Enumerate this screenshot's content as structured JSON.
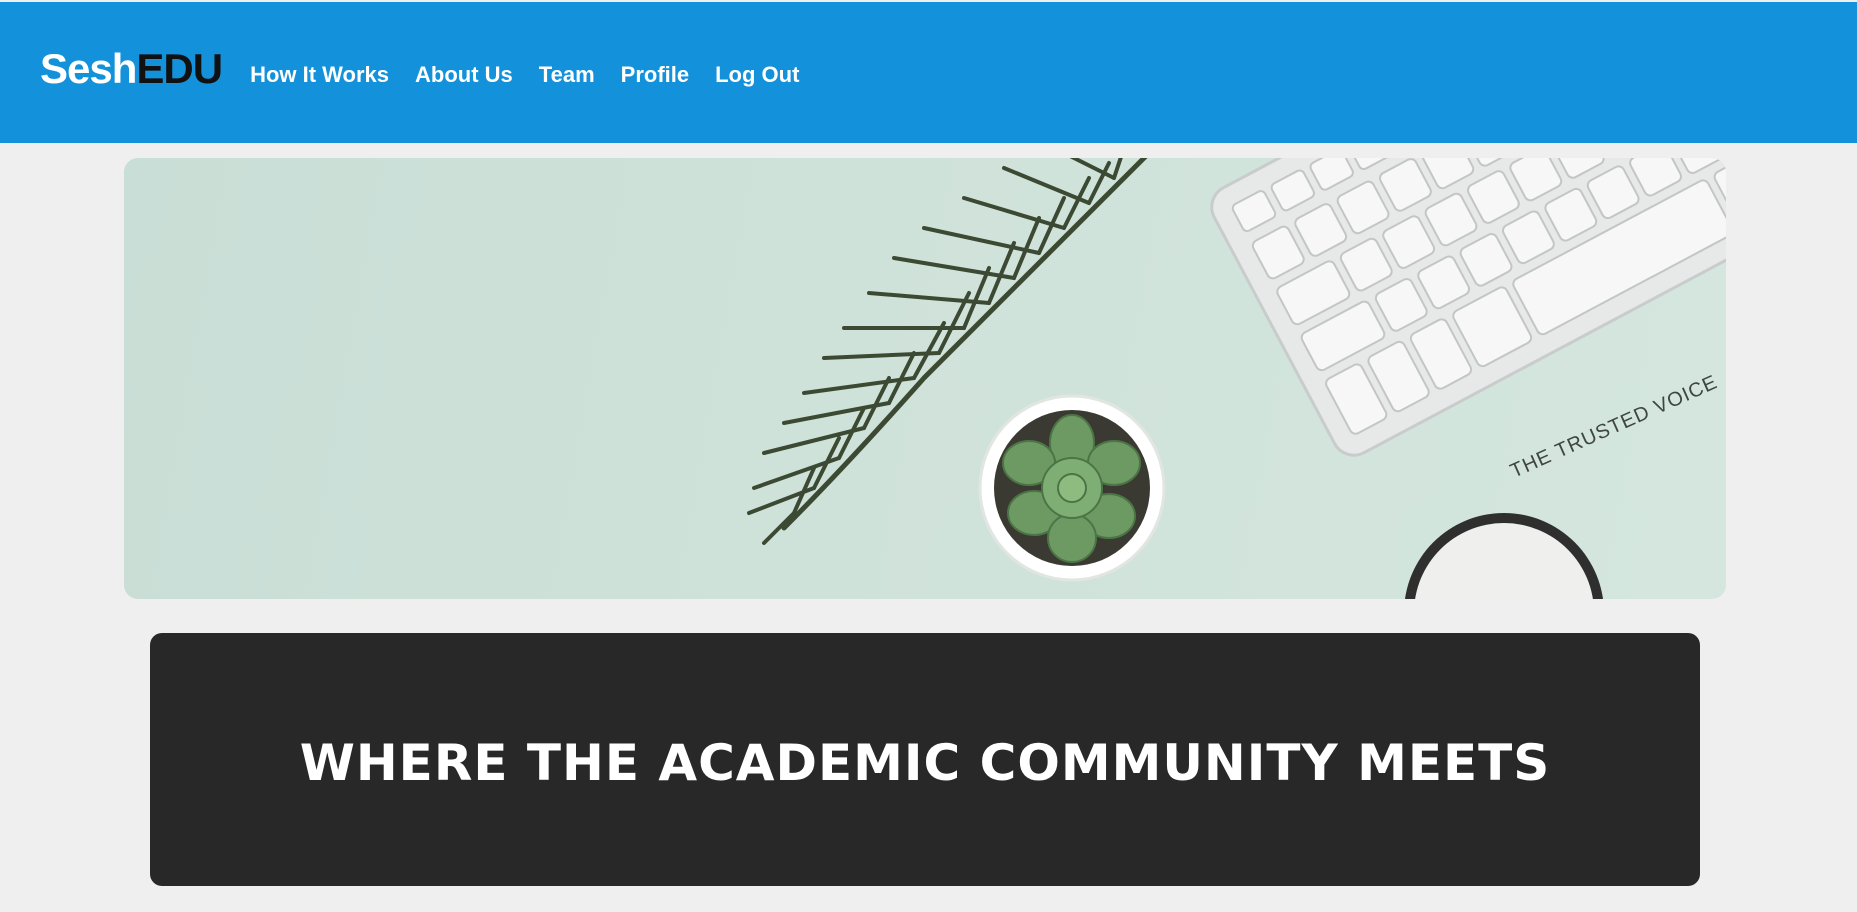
{
  "brand": {
    "part1": "Sesh",
    "part2": "EDU"
  },
  "nav": {
    "items": [
      {
        "label": "How It Works"
      },
      {
        "label": "About Us"
      },
      {
        "label": "Team"
      },
      {
        "label": "Profile"
      },
      {
        "label": "Log Out"
      }
    ]
  },
  "hero": {
    "image_text": "THE TRUSTED VOICE"
  },
  "banner": {
    "title": "WHERE THE ACADEMIC COMMUNITY MEETS"
  },
  "colors": {
    "navbar": "#1391da",
    "page_background": "#efefef",
    "banner_background": "#282828",
    "hero_background": "#cfe2da"
  }
}
